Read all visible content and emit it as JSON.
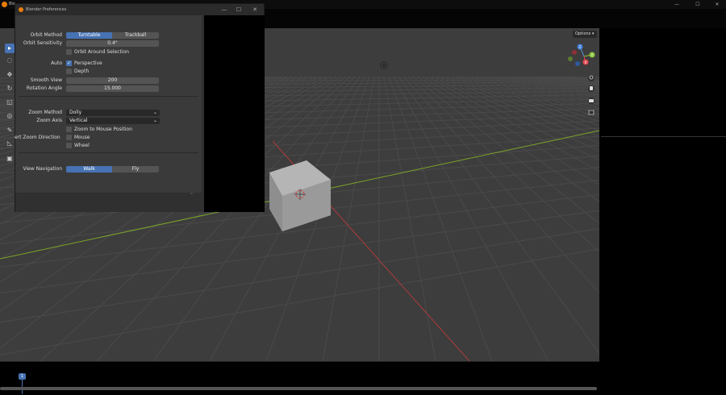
{
  "main_window": {
    "title": "Ble",
    "controls": {
      "minimize": "—",
      "maximize": "☐",
      "close": "✕"
    }
  },
  "viewport": {
    "options_label": "Options",
    "gizmo_axes": [
      "X",
      "Y",
      "Z"
    ],
    "nav_icons": [
      "zoom-icon",
      "hand-pan-icon",
      "camera-icon",
      "grid-icon"
    ]
  },
  "toolbar": {
    "tools": [
      "select-box-icon",
      "cursor-icon",
      "move-icon",
      "rotate-icon",
      "scale-icon",
      "transform-icon",
      "annotate-icon",
      "measure-icon",
      "add-cube-icon"
    ],
    "active": 0
  },
  "timeline": {
    "current_frame": "1"
  },
  "preferences": {
    "title": "Blender Preferences",
    "controls": {
      "minimize": "—",
      "maximize": "☐",
      "close": "✕"
    },
    "orbit": {
      "method_label": "Orbit Method",
      "method_options": [
        "Turntable",
        "Trackball"
      ],
      "method_selected": "Turntable",
      "sensitivity_label": "Orbit Sensitivity",
      "sensitivity_value": "0.4°",
      "around_selection_label": "Orbit Around Selection",
      "around_selection": false
    },
    "auto": {
      "label": "Auto",
      "perspective_label": "Perspective",
      "perspective": true,
      "depth_label": "Depth",
      "depth": false
    },
    "smooth_view_label": "Smooth View",
    "smooth_view_value": "200",
    "rotation_angle_label": "Rotation Angle",
    "rotation_angle_value": "15.000",
    "zoom": {
      "method_label": "Zoom Method",
      "method_value": "Dolly",
      "axis_label": "Zoom Axis",
      "axis_value": "Vertical",
      "to_mouse_label": "Zoom to Mouse Position",
      "to_mouse": false,
      "invert_label": "ert Zoom Direction",
      "mouse_label": "Mouse",
      "mouse": false,
      "wheel_label": "Wheel",
      "wheel": false
    },
    "view_navigation": {
      "label": "View Navigation",
      "options": [
        "Walk",
        "Fly"
      ],
      "selected": "Walk"
    }
  },
  "colors": {
    "accent": "#4772b3",
    "viewport_bg": "#3d3d3d",
    "grid": "#4a4a4a",
    "x_axis": "#b03a3a",
    "y_axis": "#7aa52a",
    "cube": "#a8a8a8"
  }
}
